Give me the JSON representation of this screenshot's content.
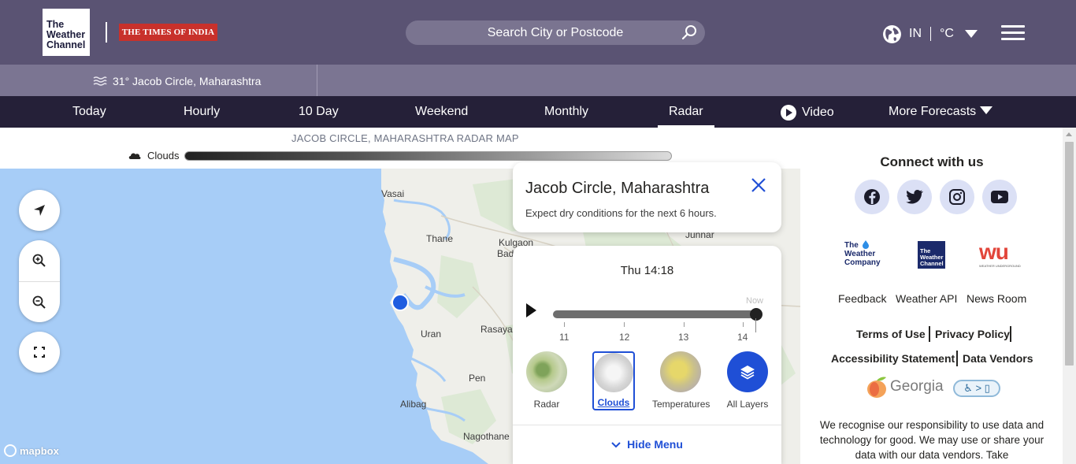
{
  "header": {
    "logo_twc_lines": [
      "The",
      "Weather",
      "Channel"
    ],
    "logo_toi": "THE TIMES OF INDIA",
    "search_placeholder": "Search City or Postcode",
    "locale_country": "IN",
    "locale_unit": "°C"
  },
  "location_bar": {
    "temp_location": "31° Jacob Circle, Maharashtra"
  },
  "nav": {
    "items": [
      "Today",
      "Hourly",
      "10 Day",
      "Weekend",
      "Monthly",
      "Radar",
      "Video",
      "More Forecasts"
    ],
    "active": "Radar"
  },
  "map": {
    "caption": "JACOB CIRCLE, MAHARASHTRA RADAR MAP",
    "legend_label": "Clouds",
    "labels": [
      "Vasai",
      "Thane",
      "Kulgaon",
      "Badl",
      "Junnar",
      "Uran",
      "Rasaya",
      "Pen",
      "Alibag",
      "Nagothane"
    ],
    "attribution": "mapbox"
  },
  "popup": {
    "title": "Jacob Circle, Maharashtra",
    "description": "Expect dry conditions for the next 6 hours."
  },
  "player": {
    "time": "Thu 14:18",
    "now_label": "Now",
    "ticks": [
      "11",
      "12",
      "13",
      "14"
    ],
    "progress": 1.0,
    "layers": [
      {
        "label": "Radar",
        "selected": false
      },
      {
        "label": "Clouds",
        "selected": true
      },
      {
        "label": "Temperatures",
        "selected": false
      },
      {
        "label": "All Layers",
        "selected": false
      }
    ],
    "hide_menu": "Hide Menu"
  },
  "sidebar": {
    "connect_title": "Connect with us",
    "social": [
      "facebook-icon",
      "twitter-icon",
      "instagram-icon",
      "youtube-icon"
    ],
    "brands": {
      "weather_company_lines": [
        "The",
        "Weather",
        "Company"
      ],
      "twc_small_lines": [
        "The",
        "Weather",
        "Channel"
      ],
      "wu": "wu",
      "wu_sub": "WEATHER UNDERGROUND"
    },
    "links": [
      "Feedback",
      "Weather API",
      "News Room"
    ],
    "legal": [
      "Terms of Use",
      "Privacy Policy",
      "Accessibility Statement",
      "Data Vendors"
    ],
    "georgia": "Georgia",
    "disclaimer": "We recognise our responsibility to use data and technology for good. We may use or share your data with our data vendors. Take"
  },
  "colors": {
    "header_bg": "#5a5373",
    "location_bar_bg": "#7b7592",
    "nav_bg": "#252038",
    "accent_blue": "#1f4fd6",
    "map_water": "#a7cdf7"
  }
}
